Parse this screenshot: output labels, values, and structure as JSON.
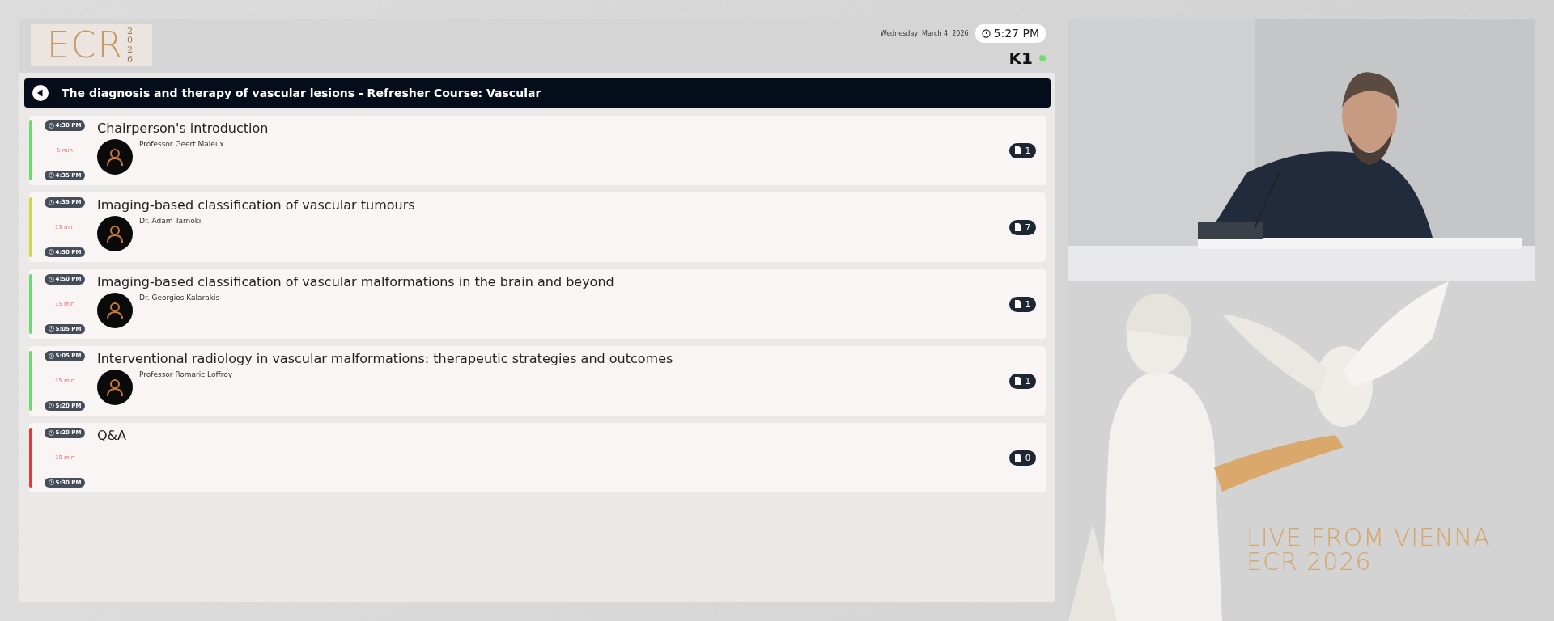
{
  "header": {
    "logo_text": "ECR",
    "logo_year": "2026",
    "date": "Wednesday, March 4, 2026",
    "time": "5:27 PM",
    "room": "K1"
  },
  "session": {
    "title": "The diagnosis and therapy of vascular lesions - Refresher Course: Vascular"
  },
  "talks": [
    {
      "start": "4:30 PM",
      "duration": "5 min",
      "end": "4:35 PM",
      "title": "Chairperson's introduction",
      "speaker": "Professor Geert Maleux",
      "documents": "1",
      "color": "#72d672"
    },
    {
      "start": "4:35 PM",
      "duration": "15 min",
      "end": "4:50 PM",
      "title": "Imaging-based classification of vascular tumours",
      "speaker": "Dr. Adam Tarnoki",
      "documents": "7",
      "color": "#c9d84c"
    },
    {
      "start": "4:50 PM",
      "duration": "15 min",
      "end": "5:05 PM",
      "title": "Imaging-based classification of vascular malformations in the brain and beyond",
      "speaker": "Dr. Georgios Kalarakis",
      "documents": "1",
      "color": "#72d672"
    },
    {
      "start": "5:05 PM",
      "duration": "15 min",
      "end": "5:20 PM",
      "title": "Interventional radiology in vascular malformations: therapeutic strategies and outcomes",
      "speaker": "Professor Romaric Loffroy",
      "documents": "1",
      "color": "#72d672"
    },
    {
      "start": "5:20 PM",
      "duration": "10 min",
      "end": "5:30 PM",
      "title": "Q&A",
      "documents": "0",
      "color": "#e03a3a"
    }
  ],
  "overlay": {
    "line_1": "LIVE FROM VIENNA",
    "line_2": "ECR 2026"
  }
}
